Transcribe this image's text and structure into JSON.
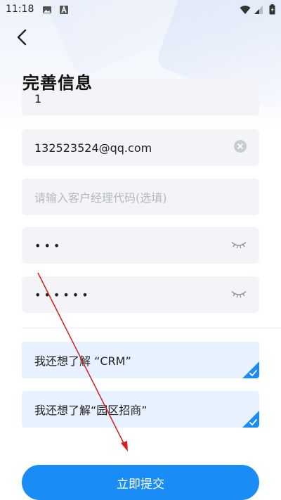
{
  "status_bar": {
    "time": "11:18"
  },
  "header": {
    "title": "完善信息"
  },
  "form": {
    "field_top_value": "1",
    "email_value": "132523524@qq.com",
    "manager_code_placeholder": "请输入客户经理代码(选填)",
    "password_masked": "•••",
    "confirm_password_masked": "••••••"
  },
  "options": [
    {
      "label": "我还想了解 “CRM”",
      "checked": true
    },
    {
      "label": "我还想了解“园区招商”",
      "checked": true
    }
  ],
  "submit": {
    "label": "立即提交"
  },
  "colors": {
    "accent": "#1a8cf5",
    "option_bg": "#e7f1ff",
    "field_bg": "#f3f4f8",
    "annotation_arrow": "#d42020"
  }
}
